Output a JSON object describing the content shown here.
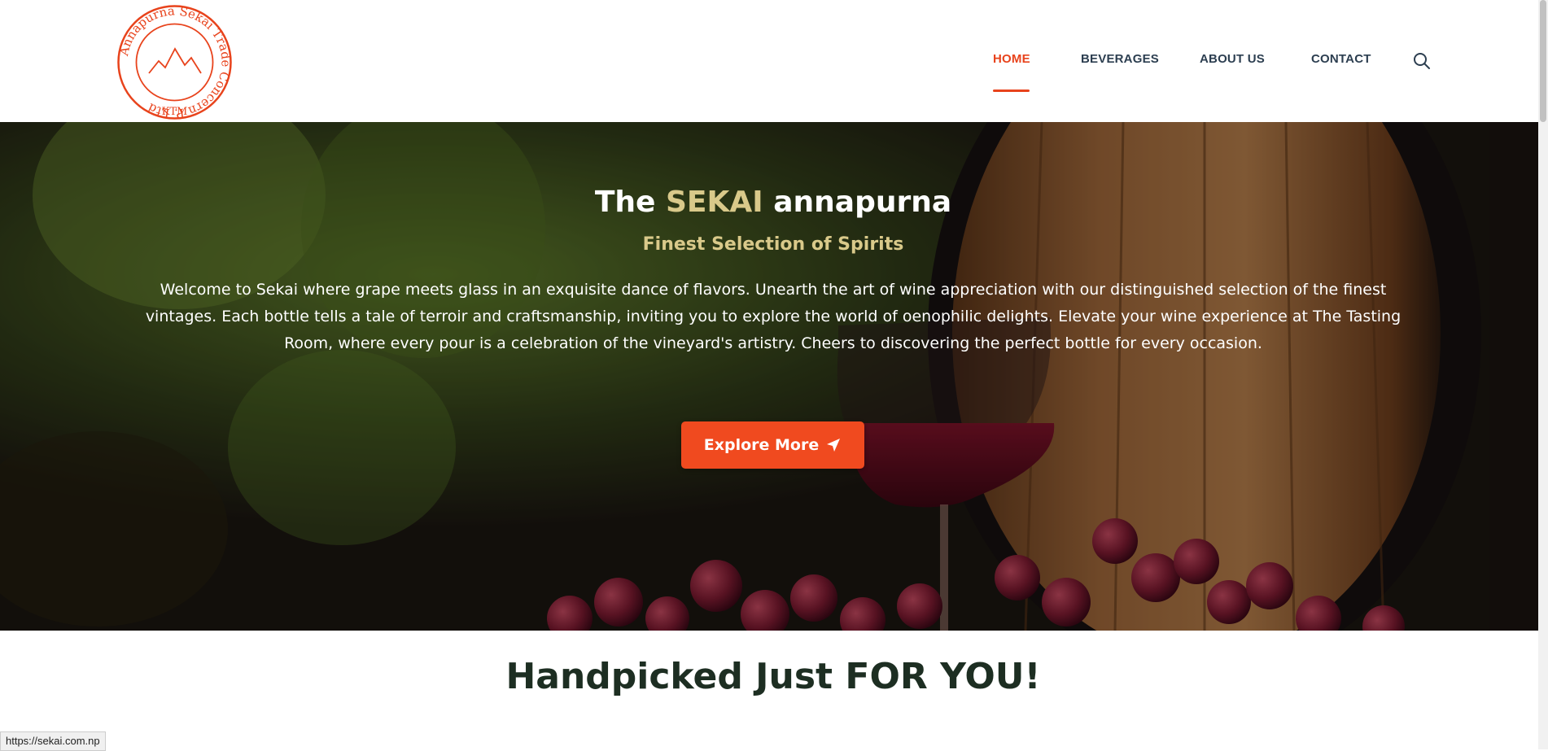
{
  "brand": {
    "logo_text": "Annapurna Sekai Trade Concern P. Ltd",
    "logo_location": "KTM",
    "accent_color": "#e8431c"
  },
  "nav": {
    "items": [
      {
        "label": "HOME",
        "active": true
      },
      {
        "label": "BEVERAGES",
        "active": false
      },
      {
        "label": "ABOUT US",
        "active": false
      },
      {
        "label": "CONTACT",
        "active": false
      }
    ],
    "search_icon": "search-icon"
  },
  "hero": {
    "title_prefix": "The",
    "title_accent": "SEKAI",
    "title_suffix": "annapurna",
    "subtitle": "Finest Selection of Spirits",
    "text": "Welcome to Sekai where grape meets glass in an exquisite dance of flavors. Unearth the art of wine appreciation with our distinguished selection of the finest vintages. Each bottle tells a tale of terroir and craftsmanship, inviting you to explore the world of oenophilic delights. Elevate your wine experience at The Tasting Room, where every pour is a celebration of the vineyard's artistry. Cheers to discovering the perfect bottle for every occasion.",
    "button_label": "Explore More",
    "button_icon": "paper-plane-icon",
    "button_color": "#f04a1f",
    "accent_text_color": "#d9c98a"
  },
  "section": {
    "title": "Handpicked Just FOR YOU!"
  },
  "status_bar": {
    "url": "https://sekai.com.np"
  }
}
